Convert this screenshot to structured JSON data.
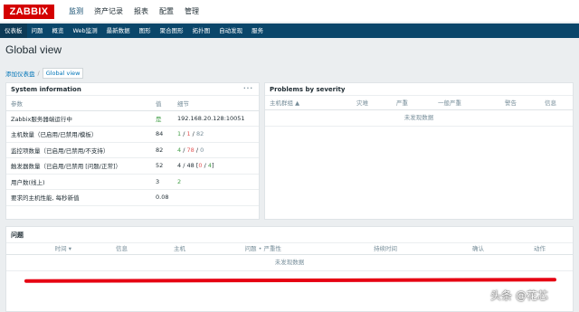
{
  "header": {
    "logo": "ZABBIX",
    "menu": [
      "监测",
      "资产记录",
      "报表",
      "配置",
      "管理"
    ]
  },
  "subnav": [
    "仪表板",
    "问题",
    "概览",
    "Web监测",
    "最新数据",
    "图形",
    "聚合图形",
    "拓扑图",
    "自动发现",
    "服务"
  ],
  "page": {
    "title": "Global view"
  },
  "breadcrumb": {
    "link": "添加仪表盘",
    "separator": "/",
    "current": "Global view"
  },
  "system_info": {
    "title": "System information",
    "menu_icon": "···",
    "columns": [
      "参数",
      "值",
      "细节"
    ],
    "rows": [
      {
        "param": "Zabbix服务器端运行中",
        "value": "是",
        "detail": "192.168.20.128:10051"
      },
      {
        "param": "主机数量（已启用/已禁用/模板）",
        "value": "84",
        "d1": "1",
        "d2": "1",
        "d3": "82"
      },
      {
        "param": "监控项数量（已启用/已禁用/不支持）",
        "value": "82",
        "d1": "4",
        "d2": "78",
        "d3": "0"
      },
      {
        "param": "触发器数量（已启用/已禁用 [问题/正常]）",
        "value": "52",
        "d1": "4",
        "d2": "48",
        "d3": "0",
        "d4": "4"
      },
      {
        "param": "用户数(线上)",
        "value": "3",
        "detail": "2"
      },
      {
        "param": "要求的主机性能, 每秒新值",
        "value": "0.08",
        "detail": ""
      }
    ]
  },
  "problems_by_severity": {
    "title": "Problems by severity",
    "columns": [
      "主机群组 ▲",
      "灾难",
      "严重",
      "一般严重",
      "警告",
      "信息"
    ],
    "no_data": "未发现数据"
  },
  "issues": {
    "title": "问题",
    "columns": [
      "时间 ▾",
      "信息",
      "主机",
      "问题 • 严重性",
      "持续时间",
      "确认",
      "动作"
    ],
    "no_data": "未发现数据"
  },
  "watermark": "头条 @花芯",
  "colors": {
    "brand": "#d40000",
    "nav": "#0a466a",
    "ok": "#429e47",
    "problem": "#e45959",
    "annotation": "#e60012"
  }
}
